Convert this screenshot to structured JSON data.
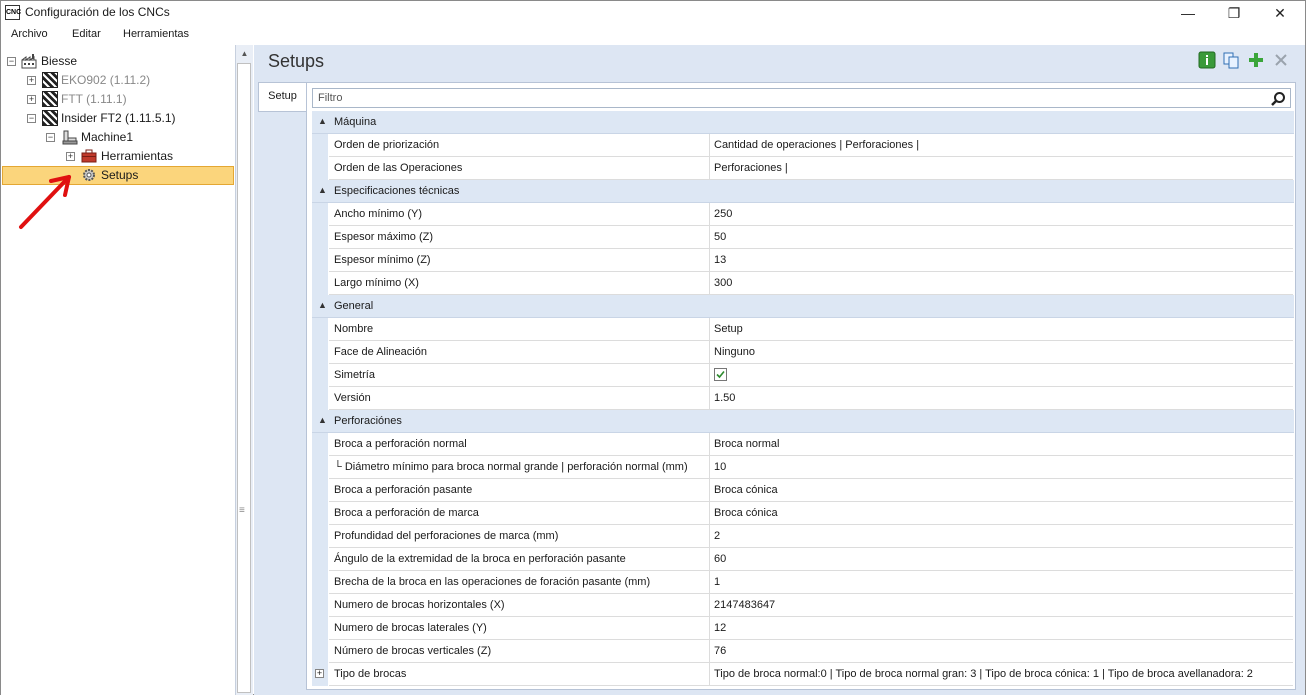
{
  "window": {
    "title": "Configuración de los CNCs",
    "app_icon_text": "CNC",
    "minimize": "—",
    "maximize": "❐",
    "close": "✕"
  },
  "menu": [
    "Archivo",
    "Editar",
    "Herramientas"
  ],
  "tree": {
    "root": "Biesse",
    "machines": [
      {
        "label": "EKO902 (1.11.2)",
        "enabled": false
      },
      {
        "label": "FTT (1.11.1)",
        "enabled": false
      },
      {
        "label": "Insider FT2 (1.11.5.1)",
        "enabled": true
      }
    ],
    "machine_child": "Machine1",
    "tools": "Herramientas",
    "setups": "Setups"
  },
  "panel": {
    "title": "Setups",
    "tab": "Setup",
    "filter_placeholder": "Filtro"
  },
  "categories": [
    {
      "name": "Máquina",
      "rows": [
        {
          "name": "Orden de priorización",
          "value": "Cantidad de operaciones | Perforaciones |"
        },
        {
          "name": "Orden de las Operaciones",
          "value": "Perforaciones |"
        }
      ]
    },
    {
      "name": "Especificaciones técnicas",
      "rows": [
        {
          "name": "Ancho mínimo (Y)",
          "value": "250"
        },
        {
          "name": "Espesor máximo (Z)",
          "value": "50"
        },
        {
          "name": "Espesor mínimo (Z)",
          "value": "13"
        },
        {
          "name": "Largo mínimo (X)",
          "value": "300"
        }
      ]
    },
    {
      "name": "General",
      "rows": [
        {
          "name": "Nombre",
          "value": "Setup"
        },
        {
          "name": "Face de Alineación",
          "value": "Ninguno"
        },
        {
          "name": "Simetría",
          "value": "",
          "checkbox": true
        },
        {
          "name": "Versión",
          "value": "1.50"
        }
      ]
    },
    {
      "name": "Perforaciónes",
      "rows": [
        {
          "name": "Broca a perforación normal",
          "value": "Broca normal"
        },
        {
          "name": "└ Diámetro mínimo para broca normal grande | perforación normal (mm)",
          "value": "10"
        },
        {
          "name": "Broca a perforación pasante",
          "value": "Broca cónica"
        },
        {
          "name": "Broca a perforación de marca",
          "value": "Broca cónica"
        },
        {
          "name": "Profundidad del perforaciones de marca (mm)",
          "value": "2"
        },
        {
          "name": "Ángulo de la extremidad de la broca en perforación pasante",
          "value": "60"
        },
        {
          "name": "Brecha de la broca en las operaciones de foración pasante (mm)",
          "value": "1"
        },
        {
          "name": "Numero de brocas horizontales (X)",
          "value": "2147483647"
        },
        {
          "name": "Numero de brocas laterales (Y)",
          "value": "12"
        },
        {
          "name": "Número de brocas verticales (Z)",
          "value": "76"
        },
        {
          "name": "Tipo de brocas",
          "value": "Tipo de broca normal:0  |  Tipo de broca normal gran: 3  |  Tipo de broca cónica: 1  |  Tipo de broca avellanadora: 2",
          "expandable": true
        }
      ]
    }
  ]
}
